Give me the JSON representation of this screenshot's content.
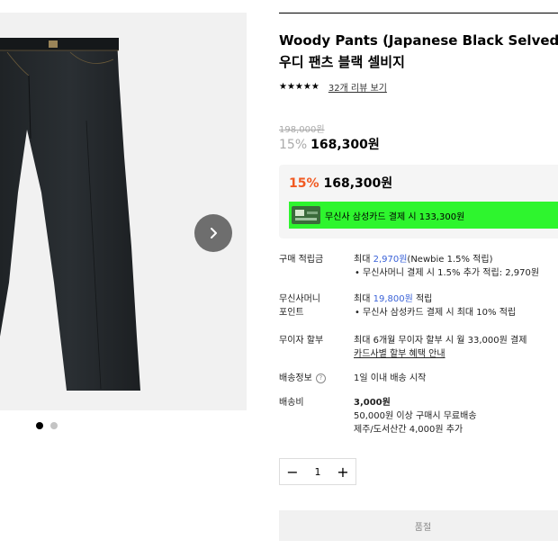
{
  "product": {
    "title_en": "Woody Pants (Japanese Black Selvedge D",
    "title_ko": "우디 팬츠 블랙 셀비지",
    "stars": "★★★★★",
    "review_link": "32개 리뷰 보기",
    "rating": 5
  },
  "price": {
    "original": "198,000원",
    "discount_pct": "15%",
    "sale": "168,300원"
  },
  "discount_box": {
    "discount_pct": "15%",
    "sale": "168,300원",
    "card_offer": "무신사 삼성카드 결제 시 133,300원",
    "banner_color": "#2ef52e"
  },
  "info_rows": {
    "points": {
      "label": "구매 적립금",
      "line1_prefix": "최대 ",
      "line1_amount": "2,970원",
      "line1_suffix": "(Newbie 1.5% 적립)",
      "line2": "무신사머니 결제 시 1.5% 추가 적립: 2,970원"
    },
    "money": {
      "label_1": "무신사머니",
      "label_2": "포인트",
      "line1_prefix": "최대 ",
      "line1_amount": "19,800원",
      "line1_suffix": " 적립",
      "line2": "무신사 삼성카드 결제 시 최대 10% 적립"
    },
    "installment": {
      "label": "무이자 할부",
      "line1": "최대 6개월 무이자 할부 시 월 33,000원 결제",
      "link": "카드사별 할부 혜택 안내"
    },
    "shipping_info": {
      "label": "배송정보",
      "help": "?",
      "value": "1일 이내 배송 시작"
    },
    "shipping_fee": {
      "label": "배송비",
      "amount": "3,000원",
      "line2": "50,000원 이상 구매시 무료배송",
      "line3": "제주/도서산간 4,000원 추가"
    }
  },
  "quantity": {
    "minus": "−",
    "value": "1",
    "plus": "+"
  },
  "soldout_button": "품절",
  "colors": {
    "accent_orange": "#f15a22",
    "link_blue": "#3a62d8"
  }
}
